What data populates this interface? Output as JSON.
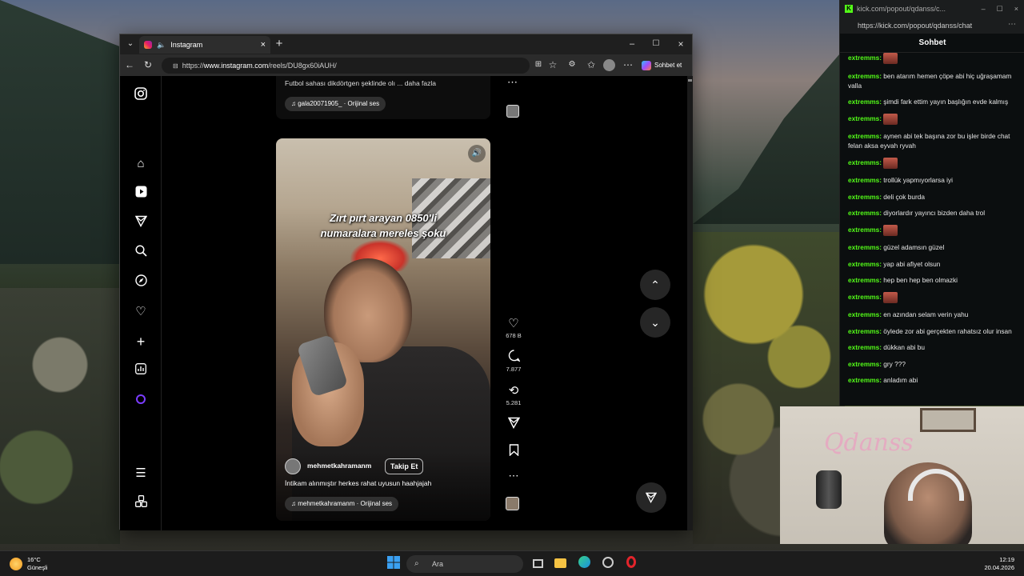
{
  "browser": {
    "tab_title": "Instagram",
    "url_prefix": "https://",
    "url_host": "www.instagram.com",
    "url_path": "/reels/DU8gx60iAUH/",
    "copilot_label": "Sohbet et"
  },
  "previous_reel": {
    "caption": "Futbol sahası dikdörtgen şeklinde olı ... daha fazla",
    "audio": "gala20071905_ · Orijinal ses"
  },
  "reel": {
    "overlay_text_line1": "Zırt pırt arayan 0850'li",
    "overlay_text_line2": "numaralara mereles şoku",
    "username": "mehmetkahramanm",
    "follow_label": "Takip Et",
    "caption": "İntikam alınmıştır herkes rahat uyusun haahjajah",
    "audio": "mehmetkahramanm · Orijinal ses",
    "likes": "678 B",
    "comments": "7.877",
    "reposts": "5.281"
  },
  "chat": {
    "window_title": "kick.com/popout/qdanss/c...",
    "url": "https://kick.com/popout/qdanss/chat",
    "header": "Sohbet",
    "messages": [
      {
        "user": "extremms:",
        "text": "",
        "emote": true
      },
      {
        "user": "extremms:",
        "text": "ben atarım hemen çöpe abi hiç uğraşamam valla"
      },
      {
        "user": "extremms:",
        "text": "şimdi fark ettim yayın başlığın evde kalmış"
      },
      {
        "user": "extremms:",
        "text": "",
        "emote": true
      },
      {
        "user": "extremms:",
        "text": "aynen abi tek başına zor bu işler birde chat felan aksa eyvah ryvah"
      },
      {
        "user": "extremms:",
        "text": "",
        "emote": true
      },
      {
        "user": "extremms:",
        "text": "trollük yapmıyorlarsa iyi"
      },
      {
        "user": "extremms:",
        "text": "deli çok burda"
      },
      {
        "user": "extremms:",
        "text": "diyorlardır yayıncı bizden daha trol"
      },
      {
        "user": "extremms:",
        "text": "",
        "emote": true
      },
      {
        "user": "extremms:",
        "text": "güzel adamsın güzel"
      },
      {
        "user": "extremms:",
        "text": "yap abi afiyet olsun"
      },
      {
        "user": "extremms:",
        "text": "hep ben hep ben olmazki"
      },
      {
        "user": "extremms:",
        "text": "",
        "emote": true
      },
      {
        "user": "extremms:",
        "text": "en azından selam verin yahu"
      },
      {
        "user": "extremms:",
        "text": "öylede zor abi gerçekten rahatsız olur insan"
      },
      {
        "user": "extremms:",
        "text": "dükkan abi bu"
      },
      {
        "user": "extremms:",
        "text": "gry ???"
      },
      {
        "user": "extremms:",
        "text": "anladım abi"
      }
    ]
  },
  "webcam": {
    "overlay_name": "Qdanss"
  },
  "taskbar": {
    "temperature": "16°C",
    "weather": "Güneşli",
    "search_placeholder": "Ara",
    "time": "12:19",
    "date": "20.04.2026"
  },
  "colors": {
    "kick_green": "#53fc18",
    "instagram_bg": "#000000"
  }
}
